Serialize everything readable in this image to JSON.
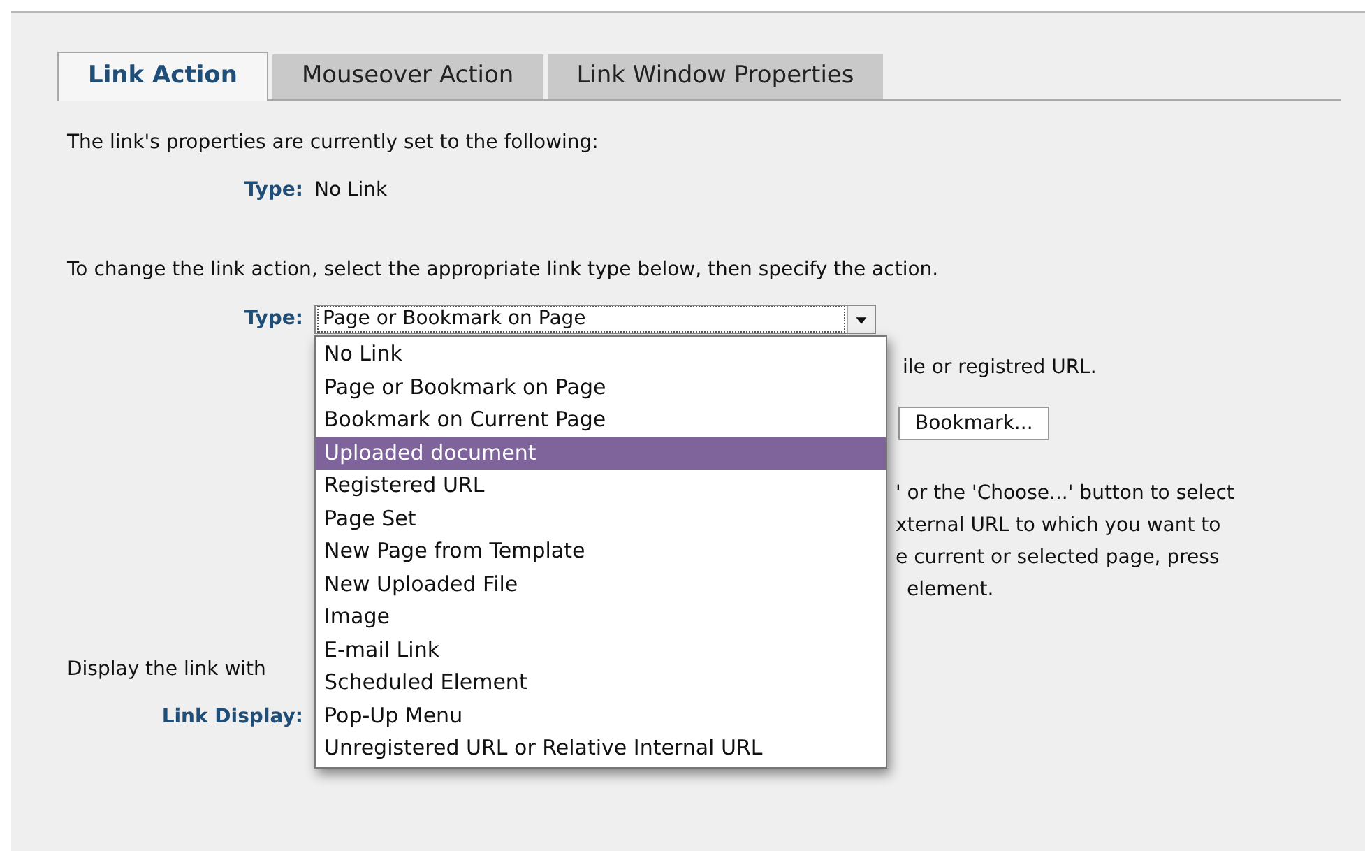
{
  "tabs": [
    {
      "label": "Link Action",
      "selected": true
    },
    {
      "label": "Mouseover Action",
      "selected": false
    },
    {
      "label": "Link Window Properties",
      "selected": false
    }
  ],
  "current": {
    "intro": "The link's properties are currently set to the following:",
    "type_label": "Type:",
    "type_value": "No Link"
  },
  "change": {
    "intro": "To change the link action, select the appropriate link type below, then specify the action.",
    "type_label": "Type:",
    "select_value": "Page or Bookmark on Page"
  },
  "dropdown": {
    "options": [
      {
        "label": "No Link",
        "selected": false
      },
      {
        "label": "Page or Bookmark on Page",
        "selected": false
      },
      {
        "label": "Bookmark on Current Page",
        "selected": false
      },
      {
        "label": "Uploaded document",
        "selected": true
      },
      {
        "label": "Registered URL",
        "selected": false
      },
      {
        "label": "Page Set",
        "selected": false
      },
      {
        "label": "New Page from Template",
        "selected": false
      },
      {
        "label": "New Uploaded File",
        "selected": false
      },
      {
        "label": "Image",
        "selected": false
      },
      {
        "label": "E-mail Link",
        "selected": false
      },
      {
        "label": "Scheduled Element",
        "selected": false
      },
      {
        "label": "Pop-Up Menu",
        "selected": false
      },
      {
        "label": "Unregistered URL or Relative Internal URL",
        "selected": false
      }
    ]
  },
  "hidden_hint": "ile or registred URL.",
  "bookmark_button": "Bookmark...",
  "help_lines": [
    "' or the 'Choose...' button to select",
    "xternal URL to which you want to",
    "e current or selected page, press",
    "element."
  ],
  "display": {
    "intro": "Display the link with",
    "label": "Link Display:"
  }
}
